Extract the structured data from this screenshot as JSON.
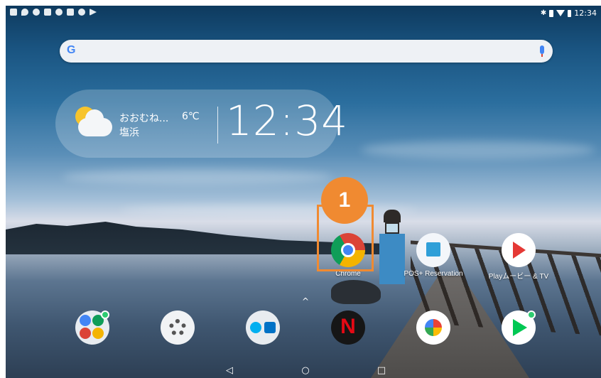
{
  "status_bar": {
    "time": "12:34",
    "left_icons": [
      "notification-icon",
      "location-icon",
      "cloud-icon",
      "video-icon",
      "disabled-icon",
      "image-icon",
      "shield-icon",
      "play-icon"
    ],
    "right_icons": [
      "bluetooth-icon",
      "vibrate-icon",
      "wifi-icon",
      "battery-icon"
    ]
  },
  "search_bar": {
    "logo": "G",
    "icon": "mic-icon"
  },
  "weather_widget": {
    "condition": "おおむね...",
    "temperature": "6℃",
    "location": "塩浜",
    "clock": "12:34",
    "icon": "partly-cloudy-icon"
  },
  "step_badge": {
    "number": "1",
    "color": "#f08a31"
  },
  "apps": [
    {
      "label": "Chrome",
      "icon": "chrome-icon"
    },
    {
      "label": "POS+ Reservation",
      "icon": "pos-reservation-icon"
    },
    {
      "label": "Playムービー & TV",
      "icon": "play-movies-icon"
    }
  ],
  "dock": [
    {
      "icon": "google-apps-folder-icon"
    },
    {
      "icon": "settings-icon"
    },
    {
      "icon": "skype-outlook-folder-icon"
    },
    {
      "icon": "netflix-icon"
    },
    {
      "icon": "google-photos-icon"
    },
    {
      "icon": "play-store-icon"
    }
  ],
  "drawer_handle": "^",
  "nav_bar": {
    "back": "◁",
    "home": "○",
    "recents": "□"
  }
}
